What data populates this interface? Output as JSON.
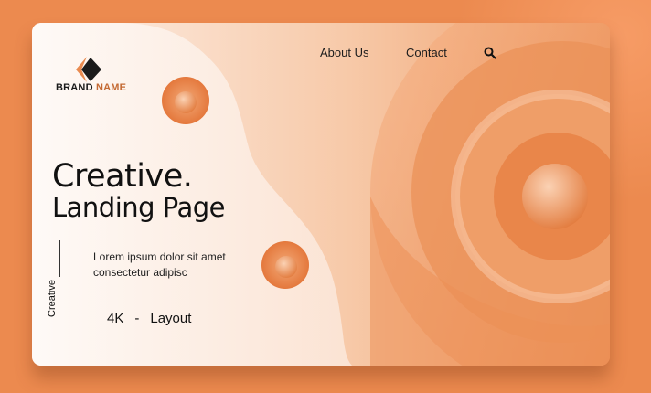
{
  "brand": {
    "name_part1": "BRAND",
    "name_part2": " NAME",
    "logo_icon": "diamond-logo-icon"
  },
  "nav": {
    "items": [
      {
        "label": "About Us"
      },
      {
        "label": "Contact"
      }
    ],
    "search_icon": "search-icon"
  },
  "hero": {
    "title_line1": "Creative.",
    "title_line2": "Landing Page",
    "description_line1": "Lorem ipsum dolor sit amet",
    "description_line2": "consectetur adipisc",
    "vertical_label": "Creative",
    "spec_left": "4K",
    "spec_sep": "-",
    "spec_right": "Layout"
  },
  "colors": {
    "background": "#ec8a4f",
    "card_light": "#fdf1ea",
    "accent": "#e8874a",
    "text": "#111111"
  }
}
